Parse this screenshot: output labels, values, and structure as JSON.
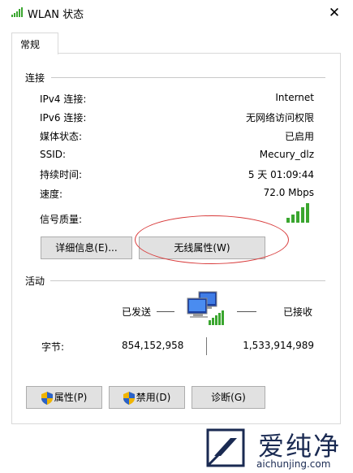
{
  "window": {
    "title": "WLAN 状态",
    "close_symbol": "✕"
  },
  "tabs": [
    {
      "label": "常规"
    }
  ],
  "connection": {
    "section_label": "连接",
    "rows": [
      {
        "label": "IPv4 连接:",
        "value": "Internet"
      },
      {
        "label": "IPv6 连接:",
        "value": "无网络访问权限"
      },
      {
        "label": "媒体状态:",
        "value": "已启用"
      },
      {
        "label": "SSID:",
        "value": "Mecury_dlz"
      },
      {
        "label": "持续时间:",
        "value": "5 天 01:09:44"
      },
      {
        "label": "速度:",
        "value": "72.0 Mbps"
      }
    ],
    "signal_label": "信号质量:",
    "signal_bars": 5,
    "details_button": "详细信息(E)...",
    "wireless_props_button": "无线属性(W)"
  },
  "activity": {
    "section_label": "活动",
    "sent_label": "已发送",
    "received_label": "已接收",
    "bytes_label": "字节:",
    "bytes_sent": "854,152,958",
    "bytes_received": "1,533,914,989"
  },
  "actions": {
    "properties_button": "属性(P)",
    "disable_button": "禁用(D)",
    "diagnose_button": "诊断(G)"
  },
  "watermark": {
    "text": "爱纯净",
    "url": "aichunjing.com"
  },
  "colors": {
    "signal": "#3aa62f",
    "annotation": "#d83a3a",
    "watermark": "#1a2a52"
  }
}
